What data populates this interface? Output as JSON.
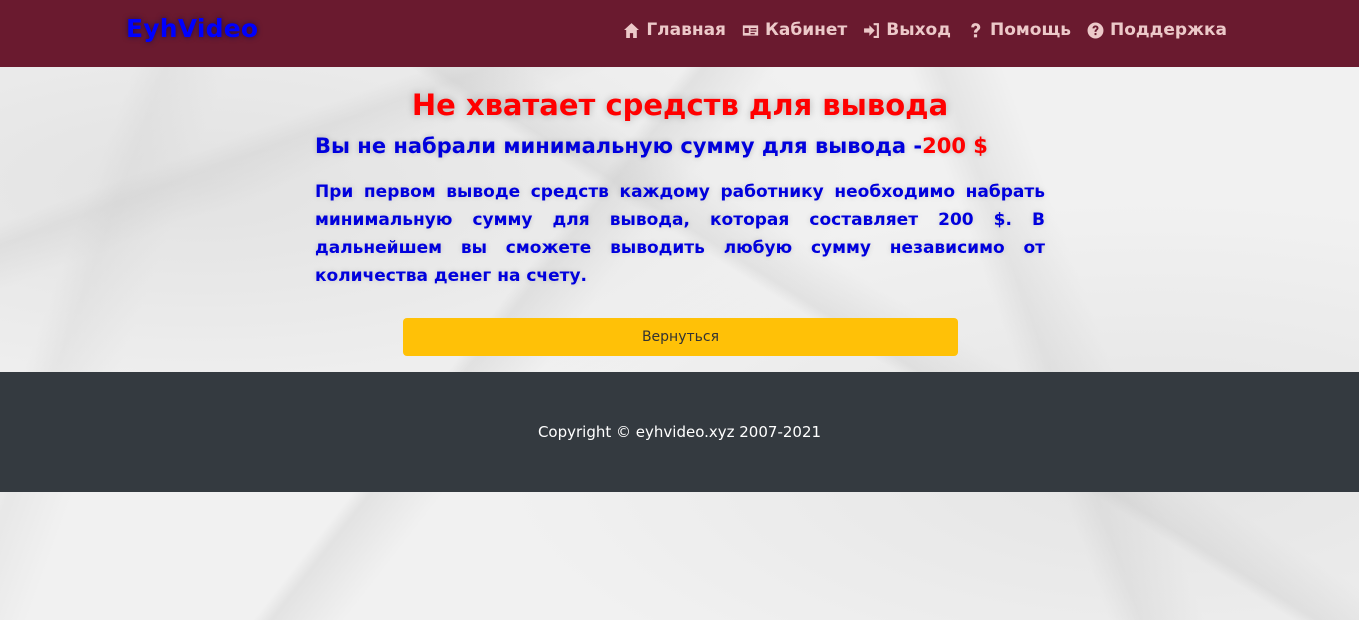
{
  "navbar": {
    "brand": "EyhVideo",
    "links": [
      {
        "label": "Главная",
        "icon": "home-icon"
      },
      {
        "label": "Кабинет",
        "icon": "id-card-icon"
      },
      {
        "label": "Выход",
        "icon": "sign-out-icon"
      },
      {
        "label": "Помощь",
        "icon": "question-icon"
      },
      {
        "label": "Поддержка",
        "icon": "question-circle-icon"
      }
    ]
  },
  "main": {
    "title": "Не хватает средств для вывода",
    "subtitle_text": "Вы не набрали минимальную сумму для вывода -",
    "subtitle_amount": "200 $",
    "paragraph": "При первом выводе средств каждому работнику необходимо набрать минимальную сумму для вывода, которая составляет 200 $. В дальнейшем вы сможете выводить любую сумму независимо от количества денег на счету.",
    "button_label": "Вернуться"
  },
  "footer": {
    "copyright": "Copyright © eyhvideo.xyz 2007-2021"
  },
  "colors": {
    "navbar": "#6a1a2f",
    "brand": "#0000ff",
    "title": "#ff0000",
    "text": "#0000dd",
    "button": "#ffc107",
    "footer": "#343a40"
  }
}
